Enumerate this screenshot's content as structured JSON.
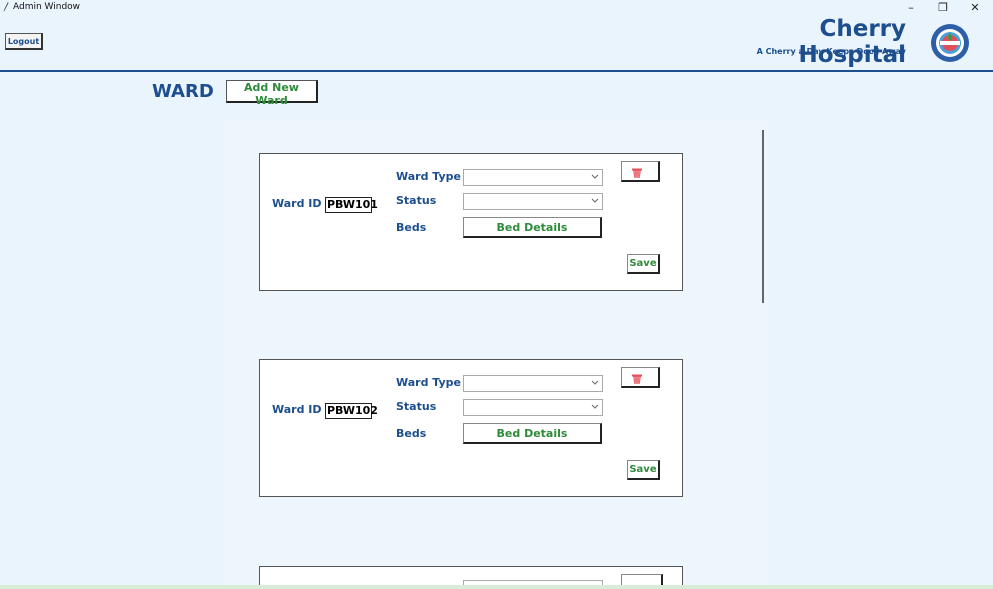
{
  "window": {
    "title": "Admin Window",
    "min_glyph": "–",
    "max_glyph": "❐",
    "close_glyph": "✕"
  },
  "header": {
    "logout_label": "Logout",
    "brand_name": "Cherry Hospital",
    "tagline": "A Cherry a Day Keeps Doc J Away"
  },
  "page": {
    "section_title": "WARD",
    "add_ward_label": "Add New Ward"
  },
  "labels": {
    "ward_id": "Ward ID",
    "ward_type": "Ward Type",
    "status": "Status",
    "beds": "Beds",
    "bed_details": "Bed Details",
    "save": "Save"
  },
  "wards": [
    {
      "id": "PBW101",
      "ward_type": "",
      "status": ""
    },
    {
      "id": "PBW102",
      "ward_type": "",
      "status": ""
    }
  ],
  "colors": {
    "brand_blue": "#1d4e8e",
    "action_green": "#2e8b3a",
    "delete_red": "#e0505a",
    "background": "#eaf4fd"
  },
  "icons": {
    "app": "feather-icon",
    "logo": "hospital-logo-icon",
    "delete": "trash-icon",
    "dropdown": "chevron-down-icon"
  }
}
